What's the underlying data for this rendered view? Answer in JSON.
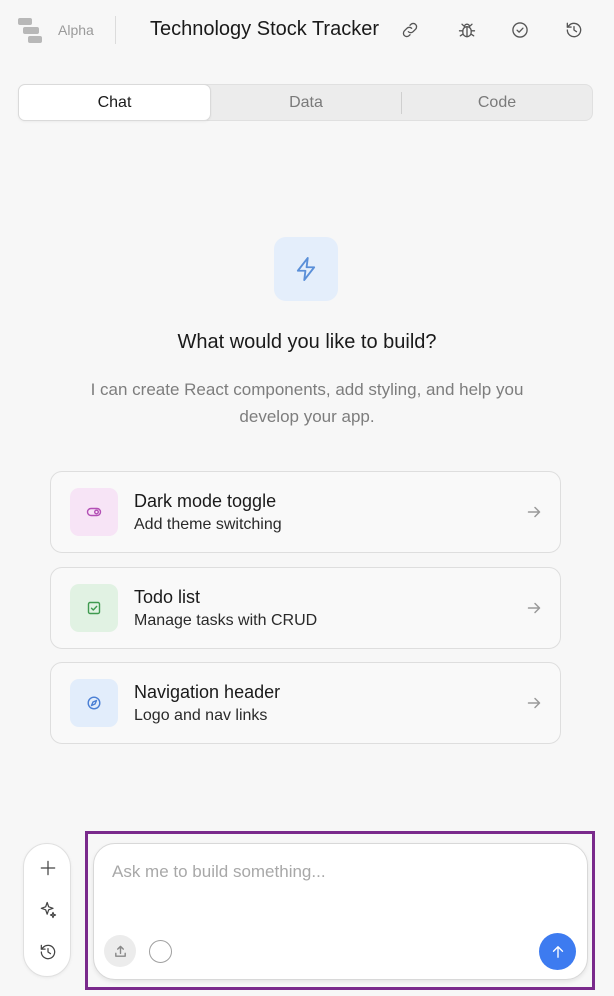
{
  "header": {
    "badge": "Alpha",
    "title": "Technology Stock Tracker",
    "icons": [
      "link-icon",
      "bug-icon",
      "check-circle-icon",
      "history-icon"
    ]
  },
  "tabs": [
    {
      "label": "Chat",
      "active": true
    },
    {
      "label": "Data",
      "active": false
    },
    {
      "label": "Code",
      "active": false
    }
  ],
  "hero": {
    "icon": "lightning-icon",
    "title": "What would you like to build?",
    "subtitle": "I can create React components, add styling, and help you develop your app."
  },
  "suggestions": [
    {
      "title": "Dark mode toggle",
      "subtitle": "Add theme switching",
      "icon": "toggle-icon",
      "icon_bg": "#f7e4f6",
      "icon_color": "#b34fb5"
    },
    {
      "title": "Todo list",
      "subtitle": "Manage tasks with CRUD",
      "icon": "checkbox-icon",
      "icon_bg": "#e1f2e3",
      "icon_color": "#3f9a4f"
    },
    {
      "title": "Navigation header",
      "subtitle": "Logo and nav links",
      "icon": "compass-icon",
      "icon_bg": "#e2edfb",
      "icon_color": "#4a7fd4"
    }
  ],
  "rail": [
    "plus-icon",
    "sparkle-icon",
    "history-icon"
  ],
  "composer": {
    "placeholder": "Ask me to build something...",
    "value": "",
    "send_color": "#3d7bf0"
  },
  "colors": {
    "highlight_outline": "#7a2a8c",
    "background": "#f7f7f7"
  }
}
